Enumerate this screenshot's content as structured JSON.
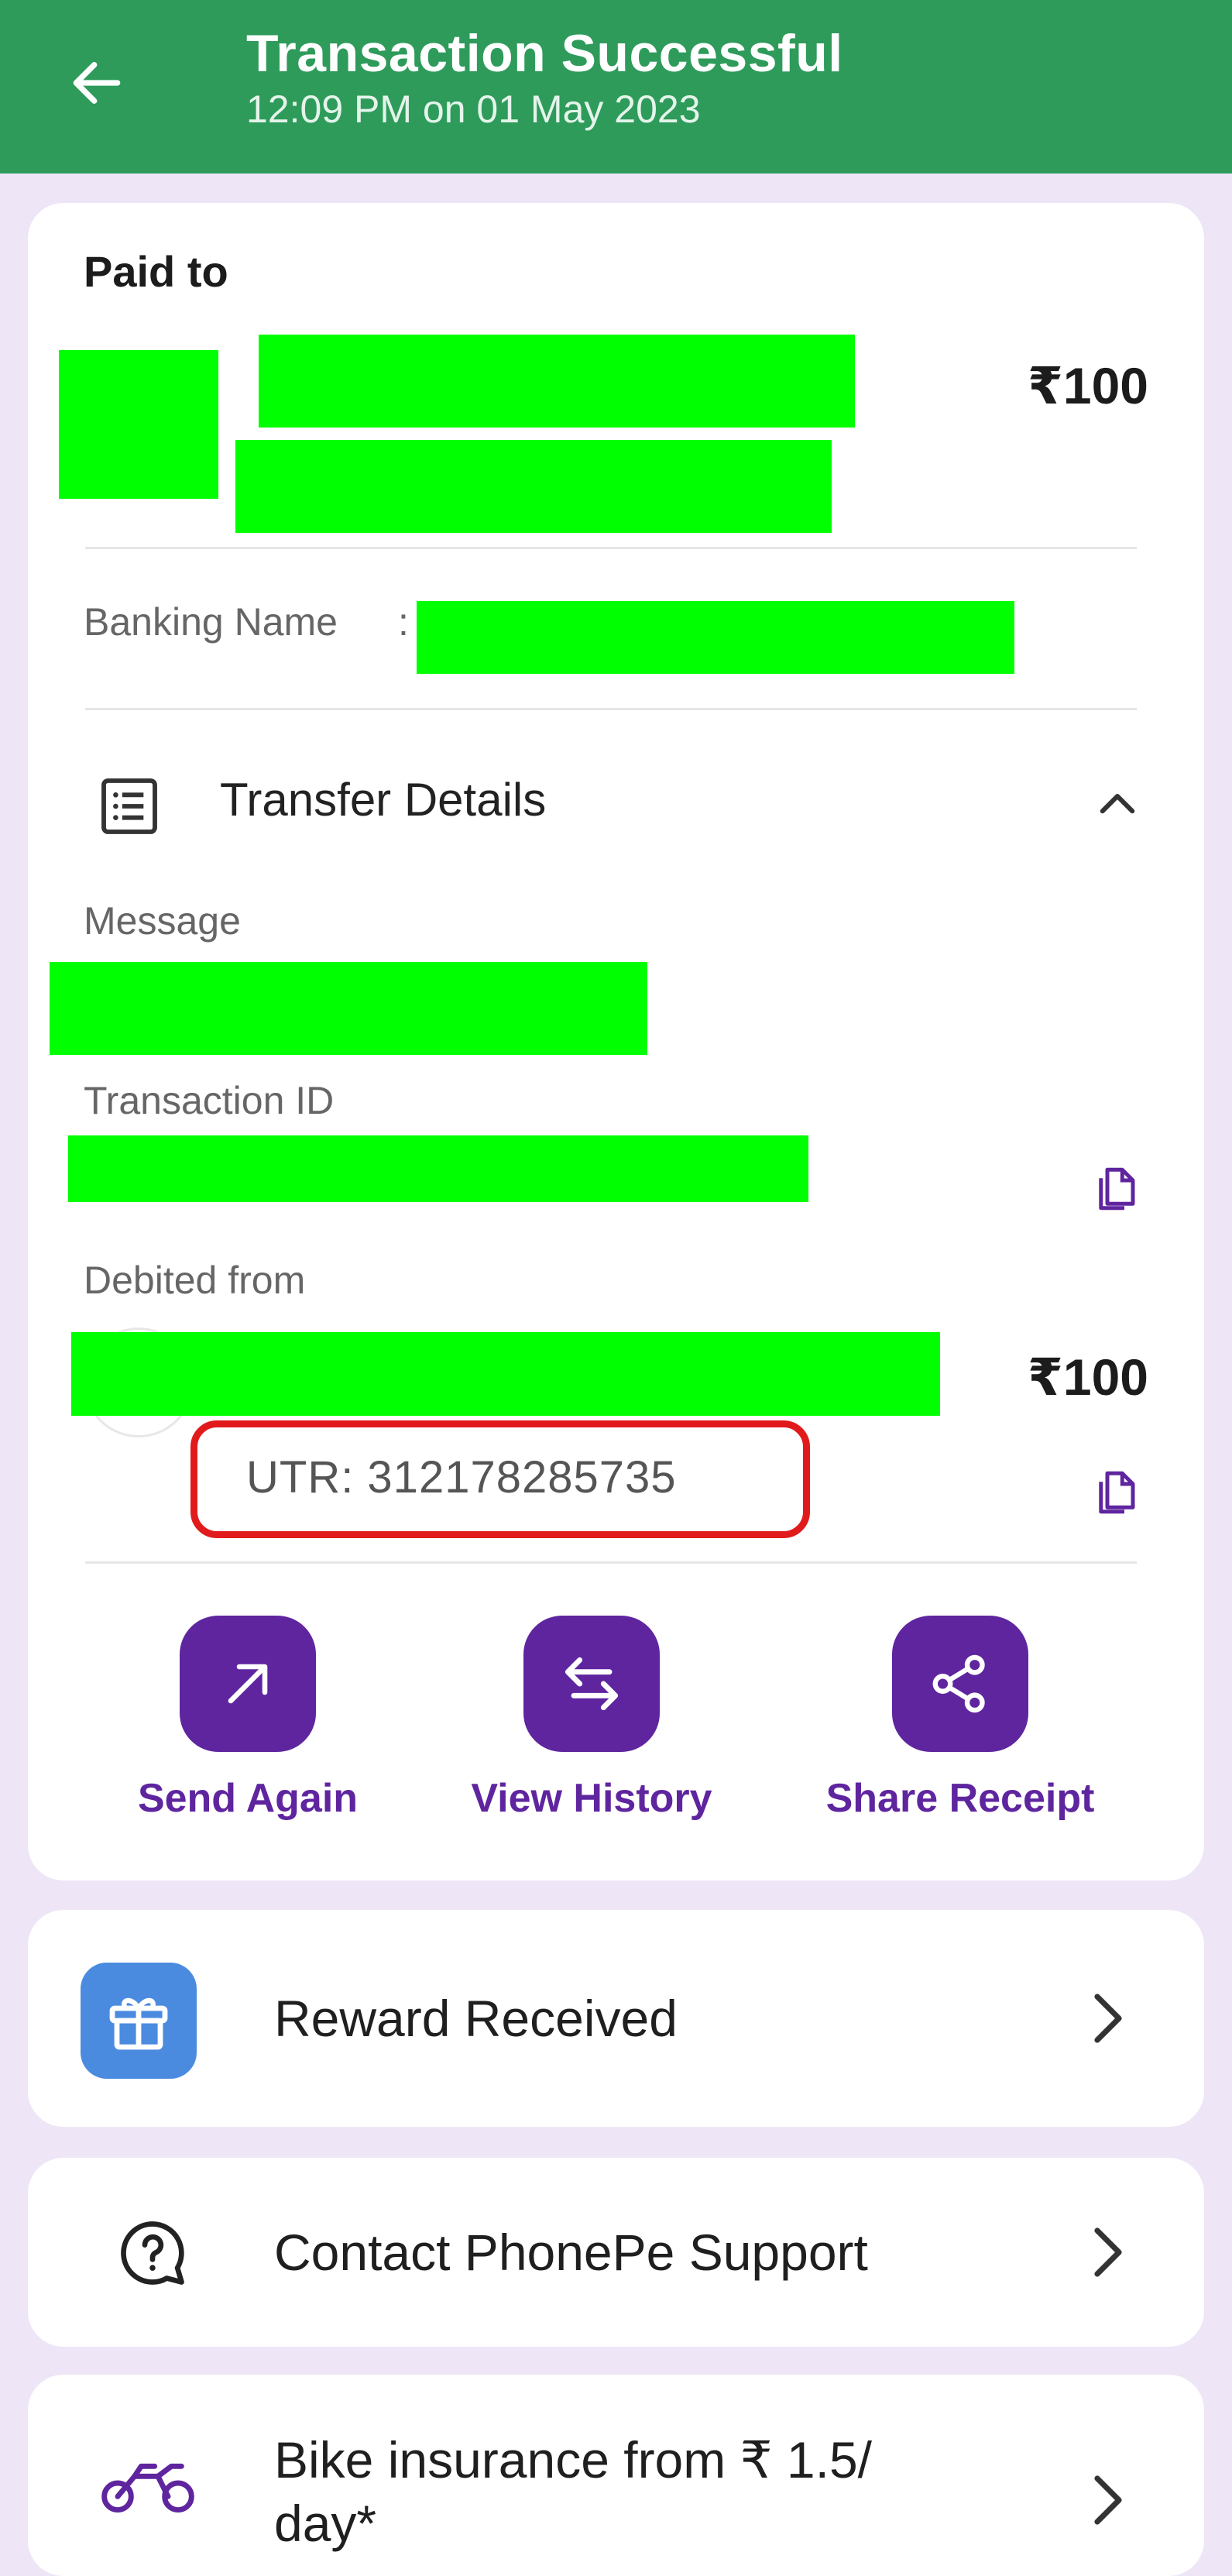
{
  "header": {
    "title": "Transaction Successful",
    "subtitle": "12:09 PM on 01 May 2023"
  },
  "payment": {
    "paid_to_label": "Paid to",
    "amount": "₹100",
    "banking_name_label": "Banking Name",
    "banking_name_sep": ":"
  },
  "transfer": {
    "title": "Transfer Details",
    "message_label": "Message",
    "transaction_id_label": "Transaction ID",
    "debited_from_label": "Debited from",
    "debited_amount": "₹100",
    "utr": "UTR: 312178285735"
  },
  "actions": [
    {
      "label": "Send Again",
      "icon": "arrow-up-right-icon"
    },
    {
      "label": "View History",
      "icon": "swap-arrows-icon"
    },
    {
      "label": "Share Receipt",
      "icon": "share-icon"
    }
  ],
  "rows": {
    "reward": "Reward Received",
    "support": "Contact PhonePe Support",
    "insurance_line1": "Bike insurance from ₹ 1.5/",
    "insurance_line2": "day*"
  },
  "colors": {
    "header_green": "#2e9b5b",
    "brand_purple": "#5f259f",
    "background": "#eee6f7",
    "redaction_green": "#00ff00",
    "highlight_red": "#e11b1b",
    "reward_blue": "#4a8be0"
  }
}
